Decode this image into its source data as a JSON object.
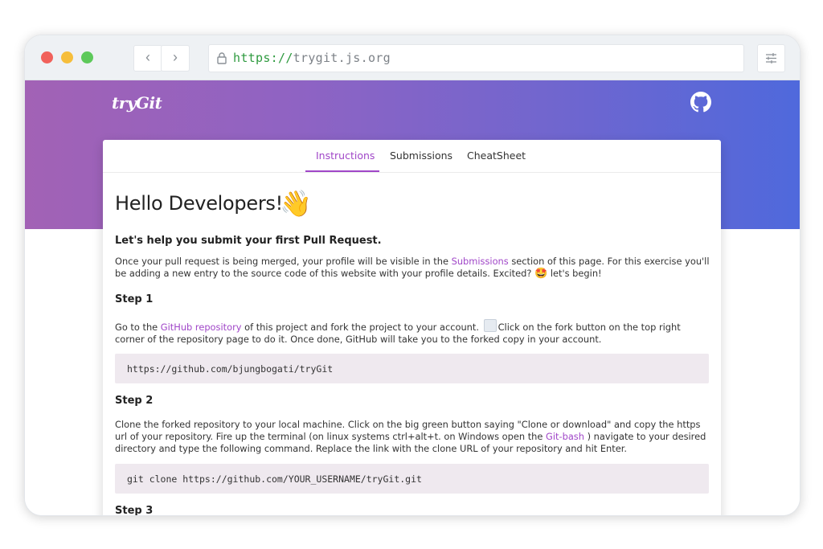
{
  "browser": {
    "url_scheme": "https://",
    "url_host": "trygit.js.org",
    "back_glyph": "‹",
    "forward_glyph": "›"
  },
  "site": {
    "logo": "tryGit",
    "github_icon": "github-icon"
  },
  "tabs": [
    "Instructions",
    "Submissions",
    "CheatSheet"
  ],
  "active_tab": "Instructions",
  "content": {
    "title": "Hello Developers!",
    "title_emoji": "👋",
    "subtitle": "Let's help you submit your first Pull Request.",
    "intro": {
      "t1": "Once your pull request is being merged, your profile will be visible in the ",
      "link": "Submissions",
      "t2": " section of this page. For this exercise you'll be adding a new entry to the source code of this website with your profile details. Excited? ",
      "emoji": "🤩",
      "t3": " let's begin!"
    },
    "step1": {
      "heading": "Step 1",
      "t1": "Go to the ",
      "link": "GitHub repository",
      "t2": " of this project and fork the project to your account. ",
      "t3": "Click on the fork button on the top right corner of the repository page to do it. Once done, GitHub will take you to the forked copy in your account.",
      "code": "https://github.com/bjungbogati/tryGit"
    },
    "step2": {
      "heading": "Step 2",
      "t1": "Clone the forked repository to your local machine. Click on the big green button saying \"Clone or download\" and copy the https url of your repository. Fire up the terminal (on linux systems ctrl+alt+t. on Windows open the ",
      "link": "Git-bash",
      "t2": " ) navigate to your desired directory and type the following command. Replace the link with the clone URL of your repository and hit Enter.",
      "code": "git clone https://github.com/YOUR_USERNAME/tryGit.git"
    },
    "step3": {
      "heading": "Step 3"
    }
  },
  "colors": {
    "accent": "#a046c8",
    "gradient_start": "#a262b5",
    "gradient_end": "#4f69dc",
    "code_bg": "#efe9ef"
  }
}
